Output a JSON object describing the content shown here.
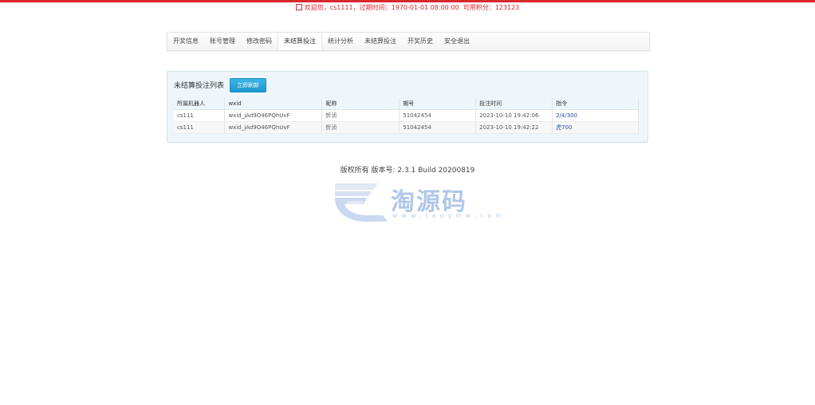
{
  "header": {
    "welcome_prefix": "欢迎您，cs1111，过期时间：",
    "expire_time": "1970-01-01 08:00:00",
    "credits_label": "可用积分：",
    "credits_value": "123123"
  },
  "nav": {
    "items": [
      {
        "label": "开奖信息"
      },
      {
        "label": "账号管理"
      },
      {
        "label": "修改密码"
      },
      {
        "label": "未结算投注"
      },
      {
        "label": "统计分析"
      },
      {
        "label": "未结算投注"
      },
      {
        "label": "开奖历史"
      },
      {
        "label": "安全退出"
      }
    ],
    "active_index": 3
  },
  "panel": {
    "title": "未结算投注列表",
    "refresh_label": "立即刷新"
  },
  "table": {
    "columns": [
      "所属机器人",
      "wxid",
      "昵称",
      "期号",
      "投注时间",
      "指令"
    ],
    "rows": [
      [
        "cs111",
        "wxid_jAd9O46PQhUvF",
        "忻浈",
        "51042454",
        "2023-10-10 19:42:06",
        "2/4/300"
      ],
      [
        "cs111",
        "wxid_jAd9O46PQhUvF",
        "忻浈",
        "51042454",
        "2023-10-10 19:42:22",
        "虎700"
      ]
    ]
  },
  "footer": {
    "text": "版权所有 版本号: 2.3.1 Build 20200819"
  },
  "watermark": {
    "text": "淘源码",
    "url": "www.taoymw.com"
  },
  "colors": {
    "accent_red": "#d9272e",
    "button_blue": "#1e96cf",
    "panel_bg": "#eef6fb",
    "command_link": "#2a4da3"
  }
}
